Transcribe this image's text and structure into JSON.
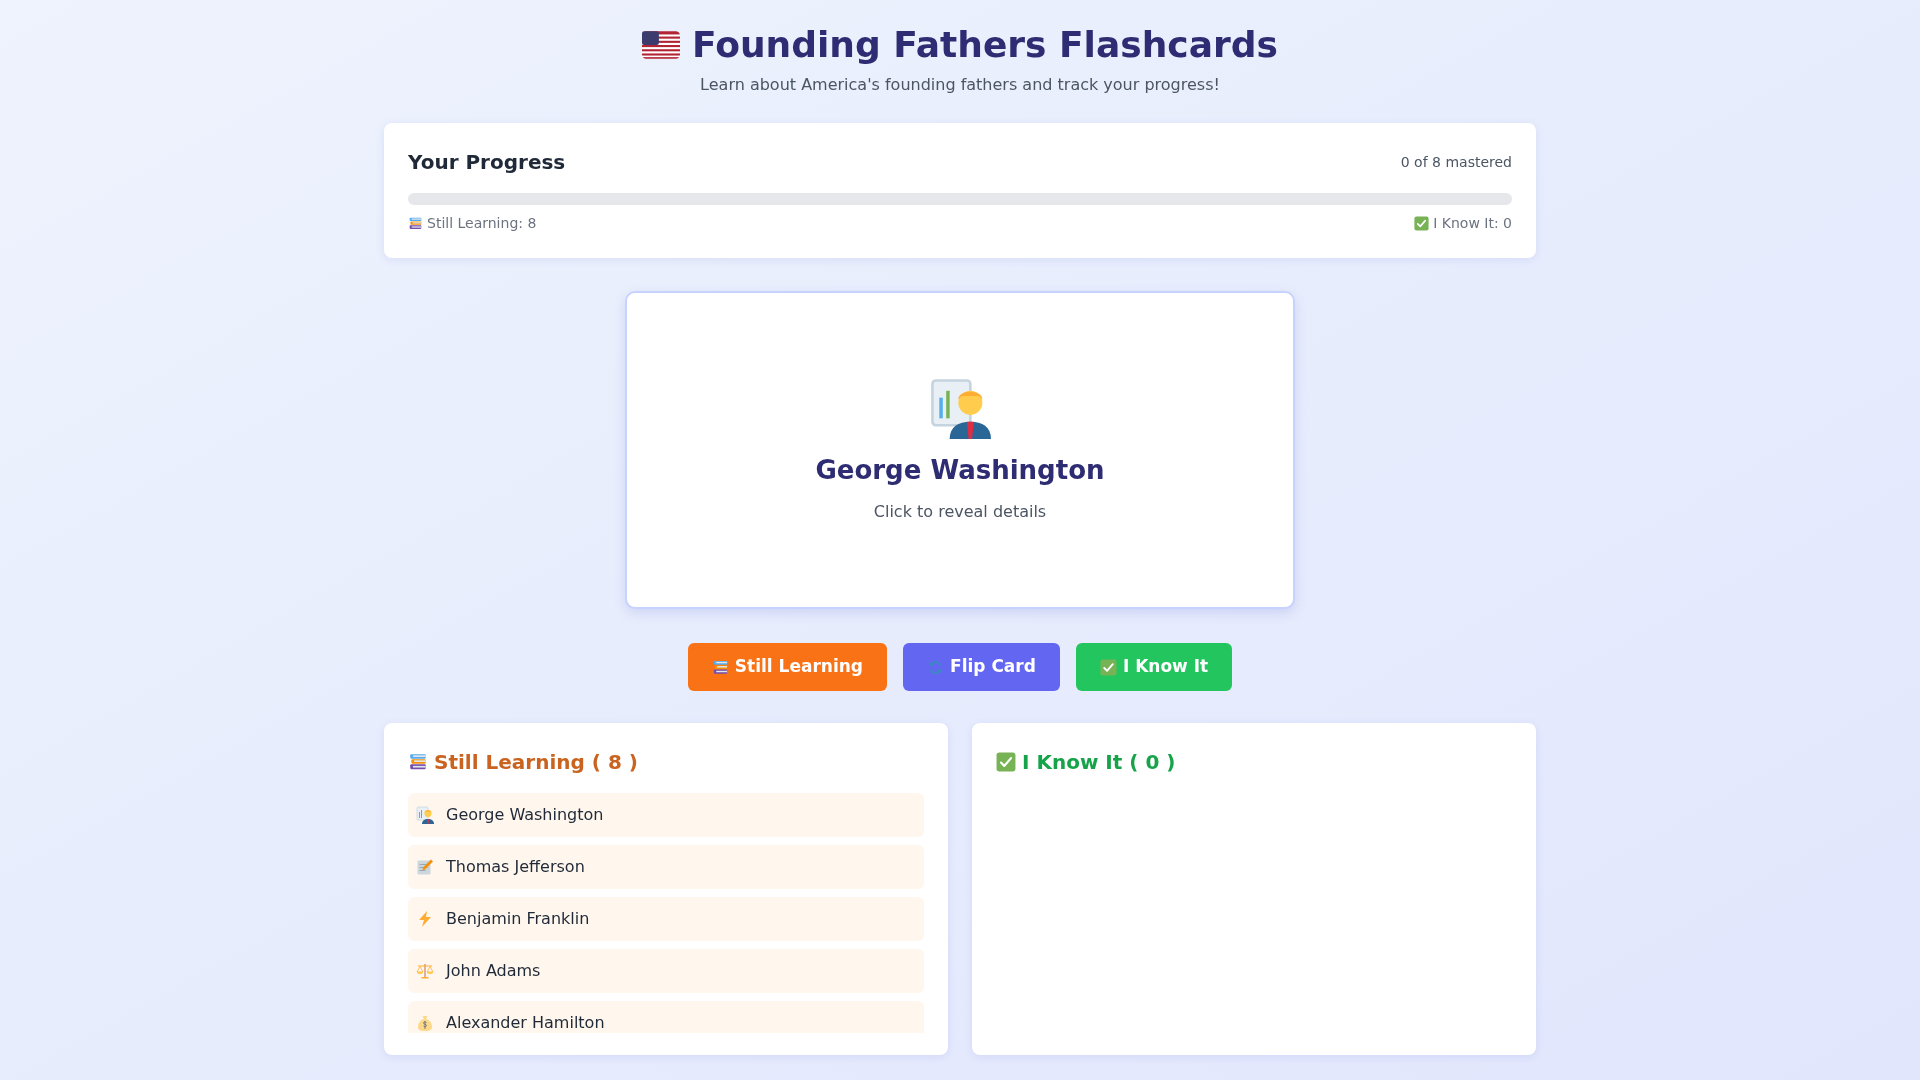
{
  "header": {
    "title": "Founding Fathers Flashcards",
    "subtitle": "Learn about America's founding fathers and track your progress!"
  },
  "progress": {
    "title": "Your Progress",
    "summary": "0 of 8 mastered",
    "level": 0,
    "learning_label": "Still Learning: 8",
    "known_label": "I Know It: 0"
  },
  "flashcard": {
    "kind": "presenter",
    "name": "George Washington",
    "hint": "Click to reveal details"
  },
  "buttons": [
    {
      "kind": "learning",
      "label": "Still Learning"
    },
    {
      "kind": "flip",
      "label": "Flip Card"
    },
    {
      "kind": "known",
      "label": "I Know It"
    }
  ],
  "still_learning": {
    "title": "Still Learning ( 8 )",
    "items": [
      {
        "kind": "presenter",
        "name": "George Washington"
      },
      {
        "kind": "memo",
        "name": "Thomas Jefferson"
      },
      {
        "kind": "lightning",
        "name": "Benjamin Franklin"
      },
      {
        "kind": "scales",
        "name": "John Adams"
      },
      {
        "kind": "moneybag",
        "name": "Alexander Hamilton"
      }
    ]
  },
  "i_know_it": {
    "title": "I Know It ( 0 )"
  }
}
